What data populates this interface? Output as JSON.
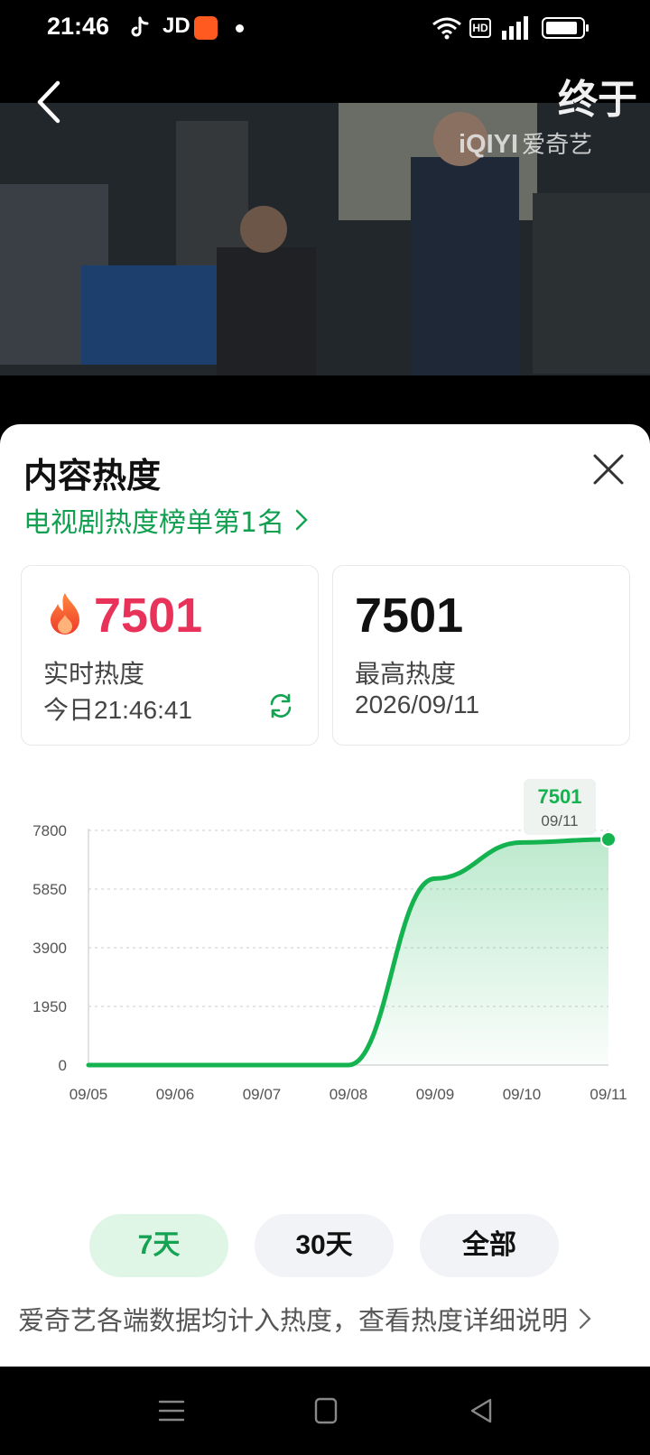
{
  "status_bar": {
    "time": "21:46",
    "app_jd": "JD",
    "hd_label": "HD"
  },
  "video": {
    "title": "终于",
    "watermark_brand": "iQIYI",
    "watermark_cn": "爱奇艺"
  },
  "panel": {
    "title": "内容热度",
    "rank_link": "电视剧热度榜单第1名",
    "realtime_card": {
      "value": "7501",
      "label": "实时热度",
      "timestamp": "今日21:46:41"
    },
    "peak_card": {
      "value": "7501",
      "label": "最高热度",
      "date": "2026/09/11"
    },
    "range_buttons": [
      "7天",
      "30天",
      "全部"
    ],
    "selected_range": "7天",
    "footer_note": "爱奇艺各端数据均计入热度，查看热度详细说明",
    "colors": {
      "accent_green": "#14a352",
      "hot_red": "#e8325a"
    }
  },
  "chart_data": {
    "type": "area",
    "x": [
      "09/05",
      "09/06",
      "09/07",
      "09/08",
      "09/09",
      "09/10",
      "09/11"
    ],
    "values": [
      0,
      0,
      0,
      0,
      6200,
      7400,
      7501
    ],
    "yticks": [
      "7800",
      "5850",
      "3900",
      "1950",
      "0"
    ],
    "ylim": [
      0,
      7800
    ],
    "grid": true,
    "tooltip": {
      "value": "7501",
      "date": "09/11"
    },
    "color": "#14b350"
  }
}
